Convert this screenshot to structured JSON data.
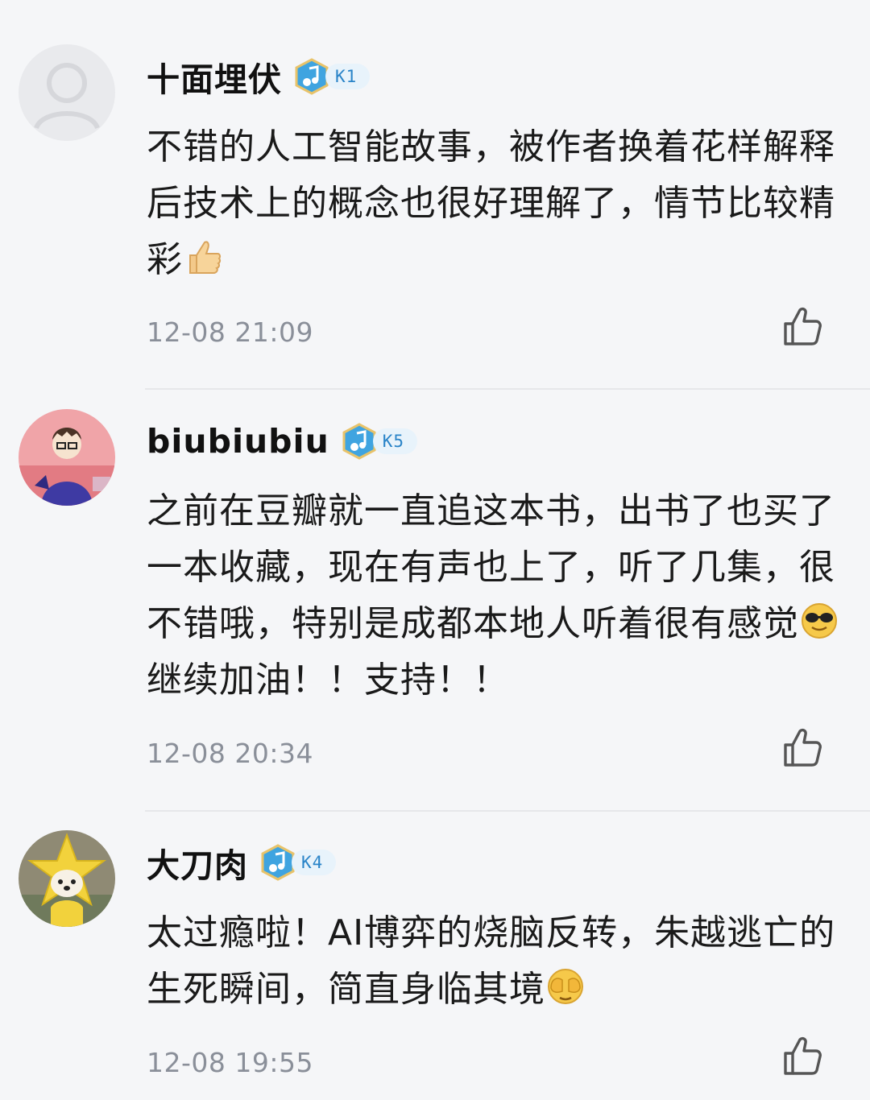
{
  "comments": [
    {
      "username": "十面埋伏",
      "level": "K1",
      "text": "不错的人工智能故事，被作者换着花样解释后技术上的概念也很好理解了，情节比较精彩",
      "emoji": "thumbs-up",
      "text_after_emoji": "",
      "timestamp": "12-08 21:09",
      "avatar": "default-avatar"
    },
    {
      "username": "biubiubiu",
      "level": "K5",
      "text": "之前在豆瓣就一直追这本书，出书了也买了一本收藏，现在有声也上了，听了几集，很不错哦，特别是成都本地人听着很有感觉",
      "emoji": "sunglasses",
      "text_after_emoji": "继续加油！！支持！！",
      "timestamp": "12-08 20:34",
      "avatar": "cartoon-person-avatar"
    },
    {
      "username": "大刀肉",
      "level": "K4",
      "text": "太过瘾啦！AI博弈的烧脑反转，朱越逃亡的生死瞬间，简直身临其境",
      "emoji": "see-no-evil-face",
      "text_after_emoji": "",
      "timestamp": "12-08 19:55",
      "avatar": "dog-in-star-costume-avatar"
    }
  ],
  "colors": {
    "background": "#f5f6f8",
    "text": "#1a1a1a",
    "timestamp": "#8a8f99",
    "badge_text": "#2a84c8",
    "badge_bg": "#e8f3fb",
    "badge_disc": "#3fa4e0",
    "divider": "#e6e7ea"
  }
}
